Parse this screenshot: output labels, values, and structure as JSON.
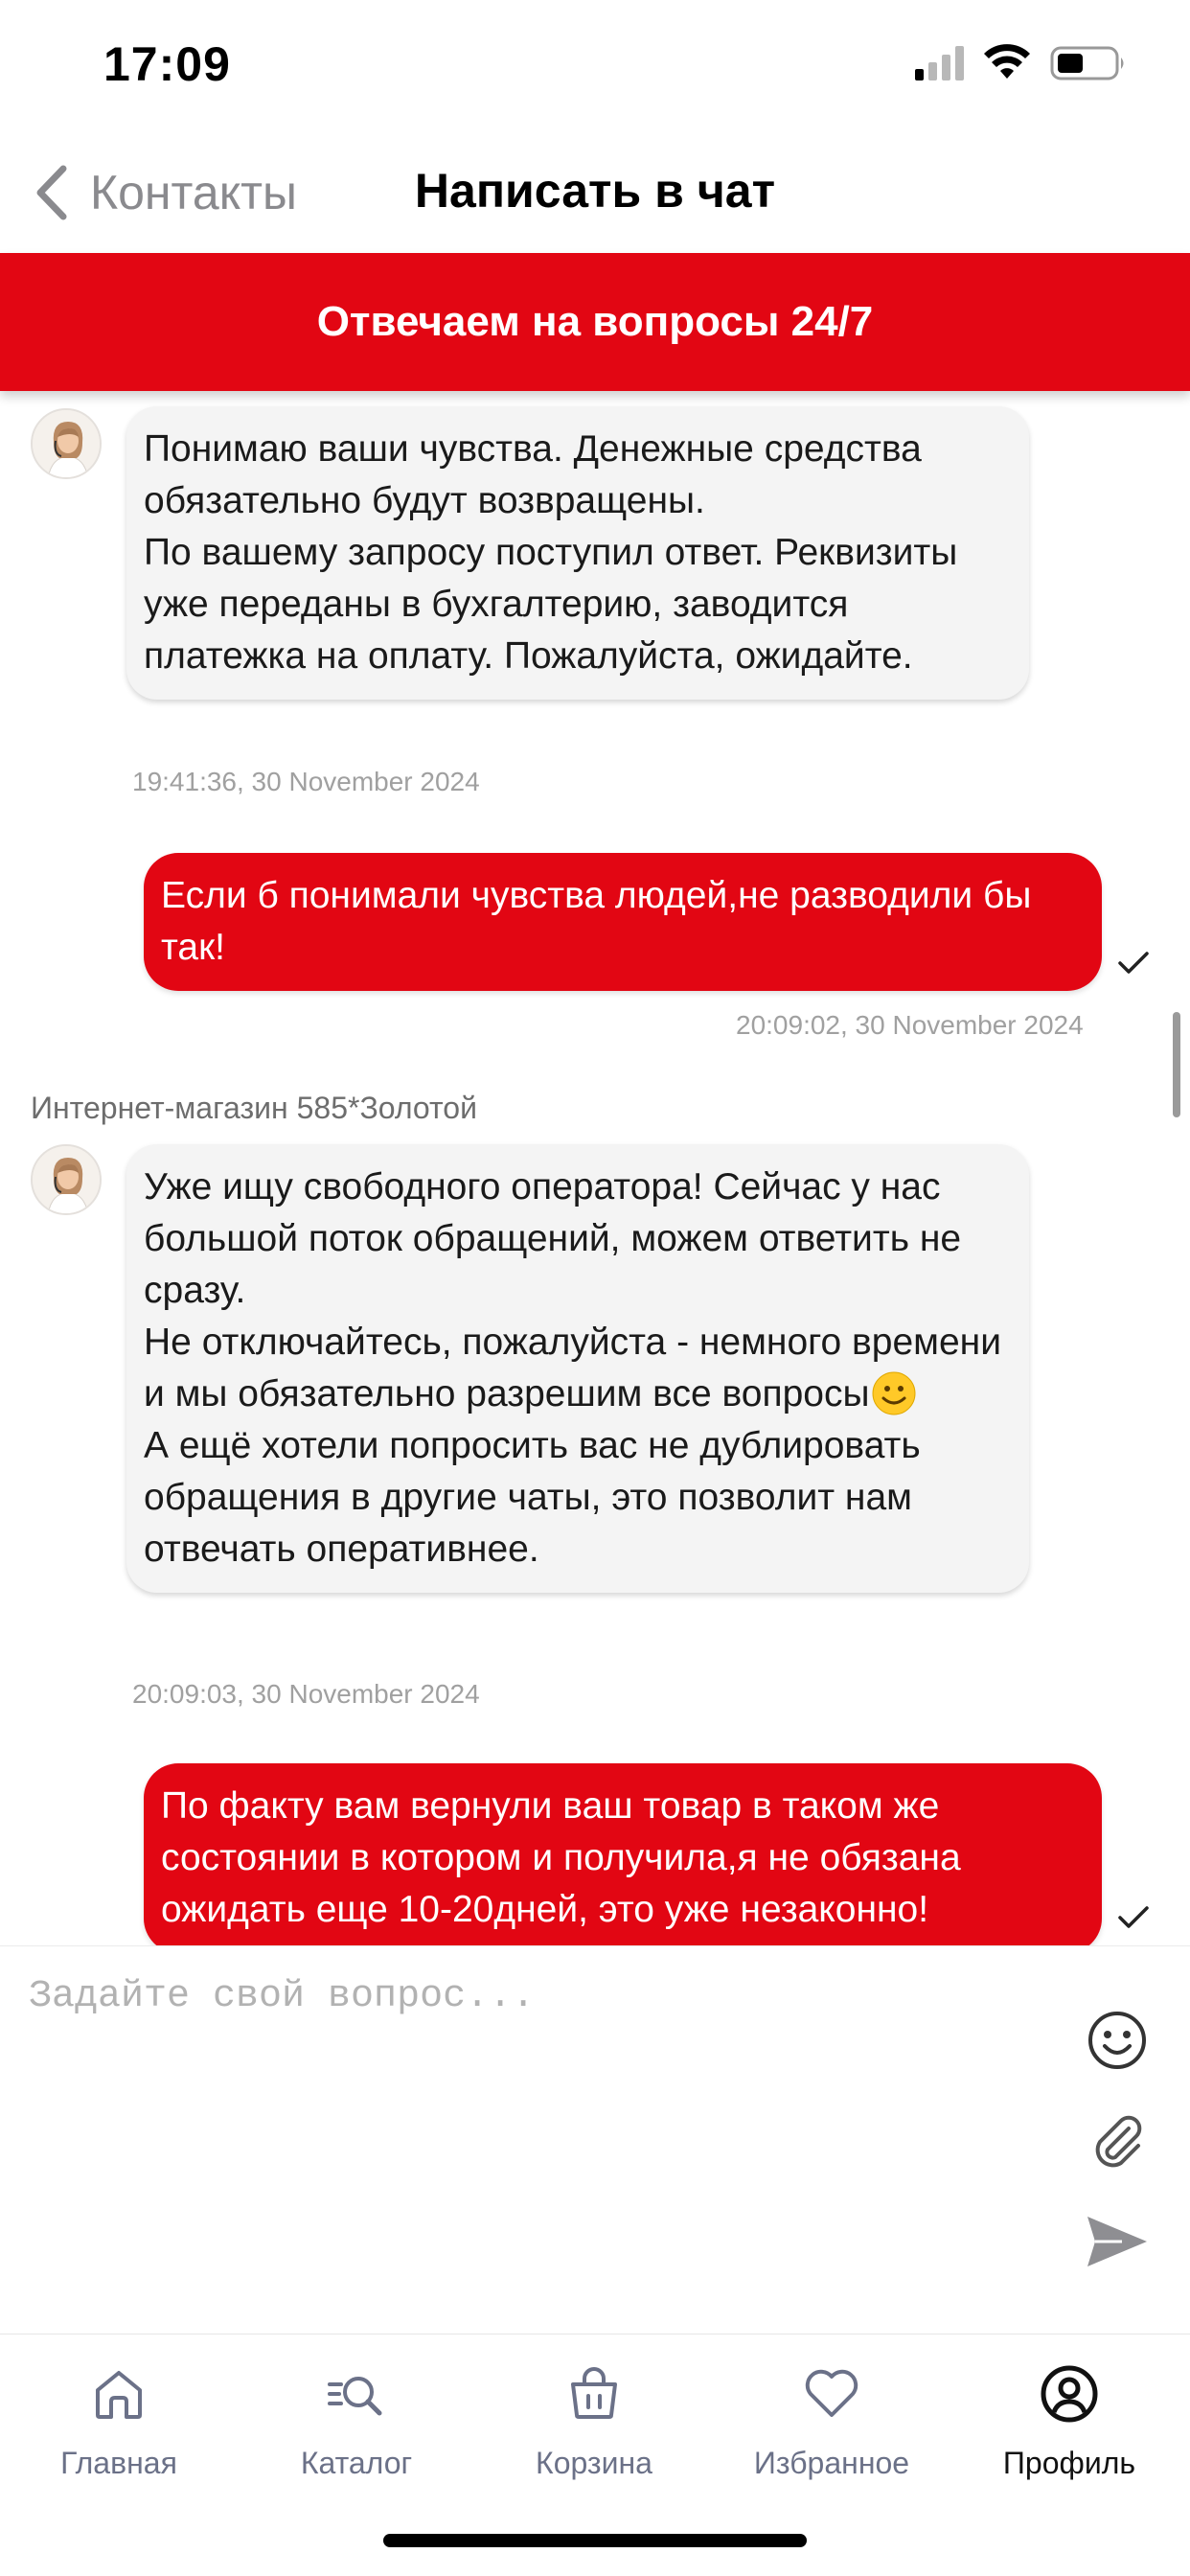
{
  "status_bar": {
    "time": "17:09"
  },
  "nav": {
    "back_label": "Контакты",
    "title": "Написать в чат"
  },
  "banner": {
    "text": "Отвечаем на вопросы 24/7"
  },
  "chat": {
    "messages": [
      {
        "direction": "incoming",
        "text": "Понимаю ваши чувства. Денежные средства обязательно будут возвращены.\nПо вашему запросу поступил ответ. Реквизиты уже переданы в бухгалтерию, заводится платежка на оплату. Пожалуйста, ожидайте.",
        "timestamp": "19:41:36, 30 November 2024"
      },
      {
        "direction": "outgoing",
        "text": "Если б понимали чувства людей,не разводили бы так!",
        "timestamp": "20:09:02, 30 November 2024"
      },
      {
        "direction": "incoming",
        "sender": "Интернет-магазин 585*Золотой",
        "text_part1": "Уже ищу свободного оператора! Сейчас у нас большой поток обращений, можем ответить не сразу.\nНе отключайтесь, пожалуйста - немного времени и мы обязательно разрешим все вопросы",
        "text_part2": "А ещё хотели попросить вас не дублировать обращения в другие чаты, это позволит нам отвечать оперативнее.",
        "timestamp": "20:09:03, 30 November 2024"
      },
      {
        "direction": "outgoing",
        "text": "По факту вам вернули ваш товар в таком же состоянии в котором и получила,я не обязана ожидать еще 10-20дней, это уже незаконно!"
      }
    ]
  },
  "input": {
    "placeholder": "Задайте свой вопрос..."
  },
  "tabs": [
    {
      "label": "Главная",
      "icon": "home-icon"
    },
    {
      "label": "Каталог",
      "icon": "catalog-search-icon"
    },
    {
      "label": "Корзина",
      "icon": "basket-icon"
    },
    {
      "label": "Избранное",
      "icon": "heart-icon"
    },
    {
      "label": "Профиль",
      "icon": "profile-icon",
      "active": true
    }
  ],
  "colors": {
    "accent": "#e20613",
    "incoming_bubble": "#f4f4f4",
    "tab_inactive": "#6b7188"
  }
}
